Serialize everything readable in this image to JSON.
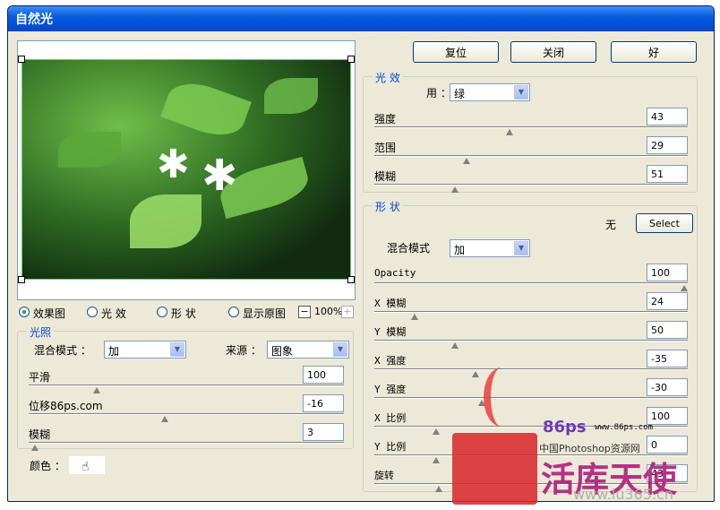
{
  "window": {
    "title": "自然光"
  },
  "buttons": {
    "reset": "复位",
    "close": "关闭",
    "ok": "好",
    "select": "Select"
  },
  "view": {
    "options": [
      "效果图",
      "光 效",
      "形 状",
      "显示原图"
    ],
    "selected": 0,
    "zoom": "100%",
    "zoom_minus": "−",
    "zoom_plus": "+"
  },
  "lighting": {
    "legend": "光照",
    "blend_label": "混合模式 ：",
    "blend_value": "加",
    "source_label": "来源 ：",
    "source_value": "图象",
    "sliders": [
      {
        "label": "平滑",
        "value": "100",
        "pos": 0.21
      },
      {
        "label": "位移86ps.com",
        "value": "-16",
        "pos": 0.43
      },
      {
        "label": "模糊",
        "value": "3",
        "pos": 0.01
      }
    ],
    "color_label": "颜色 ："
  },
  "effect": {
    "legend": "光 效",
    "use_label": "用 ：",
    "use_value": "绿",
    "sliders": [
      {
        "label": "强度",
        "value": "43",
        "pos": 0.43
      },
      {
        "label": "范围",
        "value": "29",
        "pos": 0.29
      },
      {
        "label": "模糊",
        "value": "51",
        "pos": 0.25
      }
    ]
  },
  "shape": {
    "legend": "形 状",
    "none_label": "无",
    "blend_label": "混合模式",
    "blend_value": "加",
    "sliders": [
      {
        "label": "Opacity",
        "value": "100",
        "pos": 1.0
      },
      {
        "label": "X 模糊",
        "value": "24",
        "pos": 0.12
      },
      {
        "label": "Y 模糊",
        "value": "50",
        "pos": 0.25
      },
      {
        "label": "X 强度",
        "value": "-35",
        "pos": 0.32
      },
      {
        "label": "Y 强度",
        "value": "-30",
        "pos": 0.34
      },
      {
        "label": "X 比例",
        "value": "100",
        "pos": 0.19
      },
      {
        "label": "Y 比例",
        "value": "0",
        "pos": 0.19
      },
      {
        "label": "旋转",
        "value": "43",
        "pos": 0.2
      }
    ]
  },
  "watermark": {
    "line1": "86ps",
    "line2": "www.86ps.com",
    "line3": "中国Photoshop资源网",
    "line4": "活库天使",
    "line5": "www.lu365.cn"
  },
  "colors": {
    "accent": "#0046d5",
    "title": "#0054e3"
  }
}
